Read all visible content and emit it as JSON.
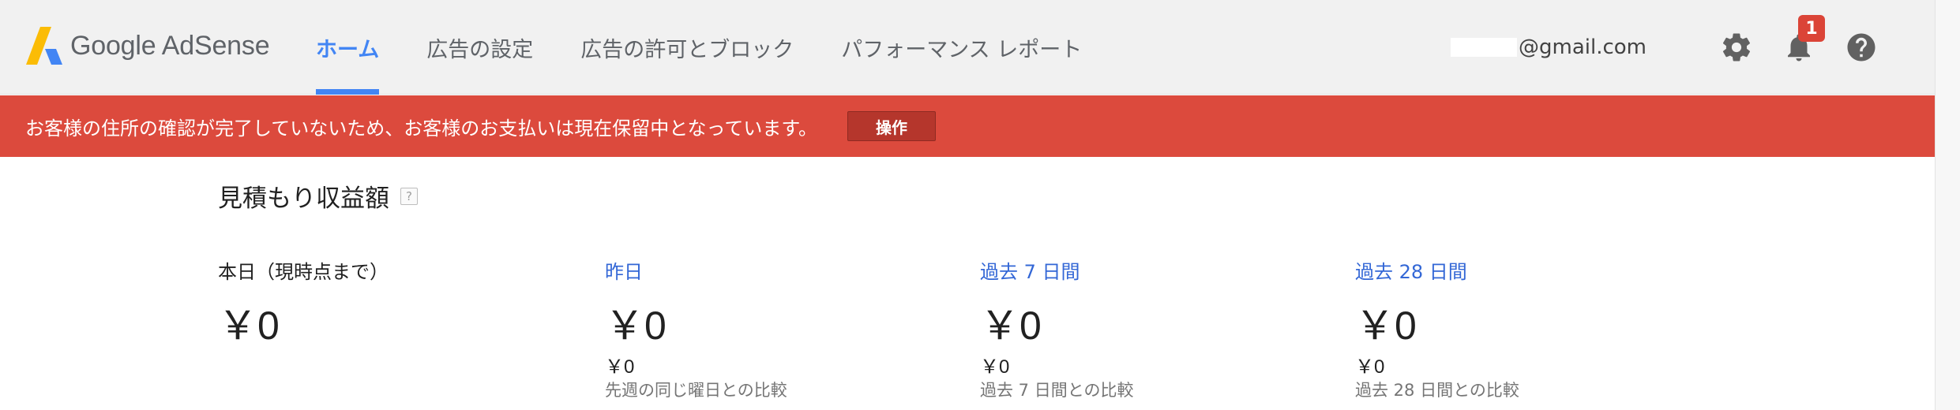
{
  "header": {
    "logo_text": "Google AdSense",
    "nav": [
      {
        "label": "ホーム",
        "active": true
      },
      {
        "label": "広告の設定",
        "active": false
      },
      {
        "label": "広告の許可とブロック",
        "active": false
      },
      {
        "label": "パフォーマンス レポート",
        "active": false
      }
    ],
    "email_suffix": "@gmail.com",
    "notification_count": "1",
    "icons": [
      "settings-icon",
      "notifications-icon",
      "help-icon"
    ]
  },
  "alert": {
    "message": "お客様の住所の確認が完了していないため、お客様のお支払いは現在保留中となっています。",
    "action_label": "操作"
  },
  "estimated_earnings": {
    "title": "見積もり収益額",
    "help": "?",
    "metrics": [
      {
        "label": "本日（現時点まで）",
        "value": "￥0",
        "compare_value": "",
        "compare_note": ""
      },
      {
        "label": "昨日",
        "value": "￥0",
        "compare_value": "￥0",
        "compare_note": "先週の同じ曜日との比較"
      },
      {
        "label": "過去 7 日間",
        "value": "￥0",
        "compare_value": "￥0",
        "compare_note": "過去 7 日間との比較"
      },
      {
        "label": "過去 28 日間",
        "value": "￥0",
        "compare_value": "￥0",
        "compare_note": "過去 28 日間との比較"
      }
    ]
  },
  "colors": {
    "accent": "#4285f4",
    "alert_bg": "#dc4a3d",
    "badge": "#db4437"
  }
}
